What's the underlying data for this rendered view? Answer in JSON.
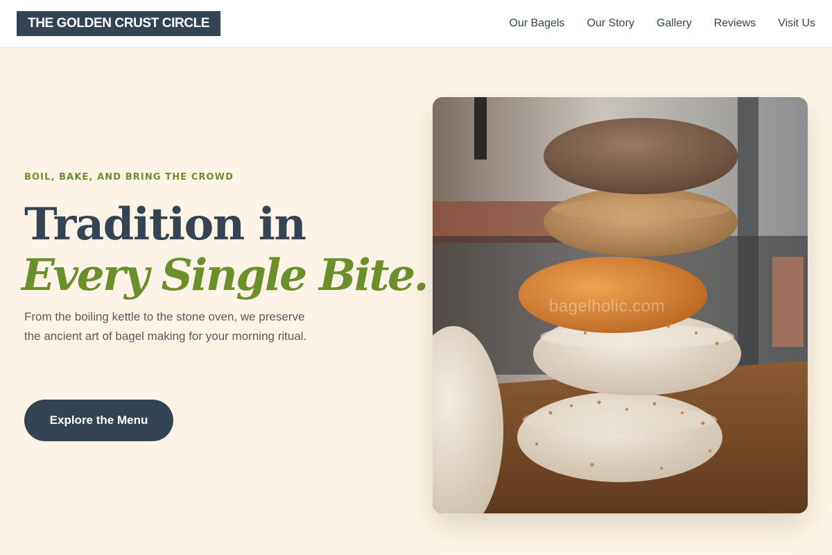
{
  "header": {
    "logo": "THE GOLDEN CRUST CIRCLE",
    "nav": [
      {
        "label": "Our Bagels"
      },
      {
        "label": "Our Story"
      },
      {
        "label": "Gallery"
      },
      {
        "label": "Reviews"
      },
      {
        "label": "Visit Us"
      }
    ]
  },
  "hero": {
    "eyebrow": "BOIL, BAKE, AND BRING THE CROWD",
    "headline_line1": "Tradition in",
    "headline_line2": "Every Single Bite.",
    "subtext": "From the boiling kettle to the stone oven, we preserve the ancient art of bagel making for your morning ritual.",
    "cta_label": "Explore the Menu",
    "image_watermark": "bagelholic.com"
  },
  "colors": {
    "navy": "#354452",
    "accent_green": "#6b8f2a",
    "background": "#fdf4e7"
  }
}
